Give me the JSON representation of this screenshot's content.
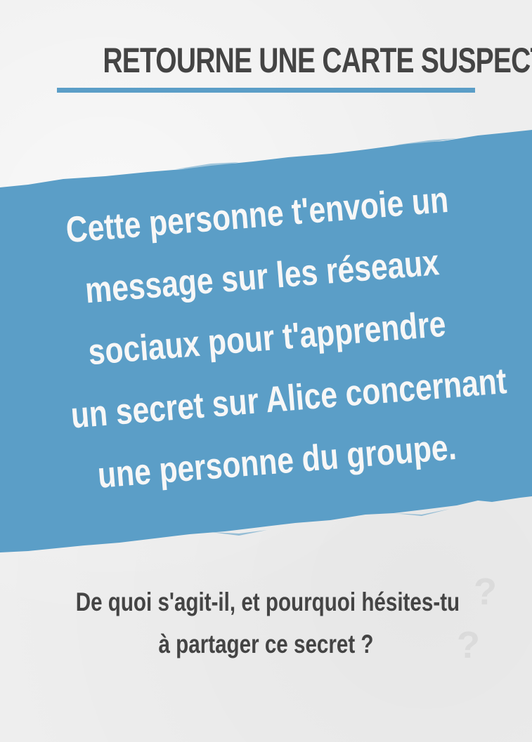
{
  "card": {
    "title": "RETOURNE UNE CARTE SUSPECT",
    "accent_color": "#5b9ec7",
    "banner_color": "#5b9ec7",
    "prompt_lines": [
      "Cette personne t'envoie un",
      "message sur les réseaux",
      "sociaux pour t'apprendre",
      "un secret sur Alice concernant",
      "une personne du groupe."
    ],
    "question_lines": [
      "De quoi s'agit-il, et pourquoi hésites-tu",
      "à partager ce secret ?"
    ]
  }
}
